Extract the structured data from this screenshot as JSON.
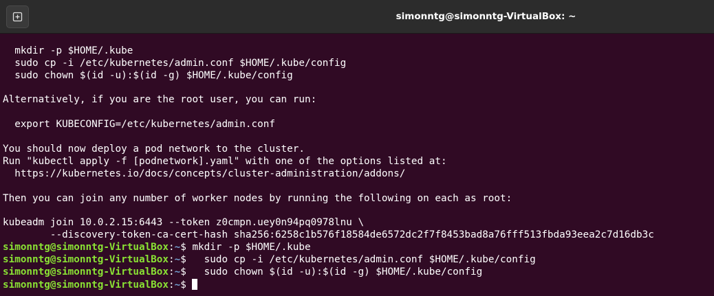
{
  "window": {
    "title": "simonntg@simonntg-VirtualBox: ~",
    "new_tab_icon": "new-tab-icon"
  },
  "colors": {
    "background": "#300a24",
    "titlebar": "#2c2c2c",
    "prompt_user": "#8ae234",
    "prompt_path": "#729fcf",
    "text": "#ffffff"
  },
  "output": [
    "",
    "  mkdir -p $HOME/.kube",
    "  sudo cp -i /etc/kubernetes/admin.conf $HOME/.kube/config",
    "  sudo chown $(id -u):$(id -g) $HOME/.kube/config",
    "",
    "Alternatively, if you are the root user, you can run:",
    "",
    "  export KUBECONFIG=/etc/kubernetes/admin.conf",
    "",
    "You should now deploy a pod network to the cluster.",
    "Run \"kubectl apply -f [podnetwork].yaml\" with one of the options listed at:",
    "  https://kubernetes.io/docs/concepts/cluster-administration/addons/",
    "",
    "Then you can join any number of worker nodes by running the following on each as root:",
    "",
    "kubeadm join 10.0.2.15:6443 --token z0cmpn.uey0n94pq0978lnu \\",
    "        --discovery-token-ca-cert-hash sha256:6258c1b576f18584de6572dc2f7f8453bad8a76fff513fbda93eea2c7d16db3c"
  ],
  "prompt": {
    "user_host": "simonntg@simonntg-VirtualBox",
    "colon": ":",
    "path": "~",
    "dollar": "$"
  },
  "commands": [
    " mkdir -p $HOME/.kube",
    "   sudo cp -i /etc/kubernetes/admin.conf $HOME/.kube/config",
    "   sudo chown $(id -u):$(id -g) $HOME/.kube/config",
    " "
  ]
}
